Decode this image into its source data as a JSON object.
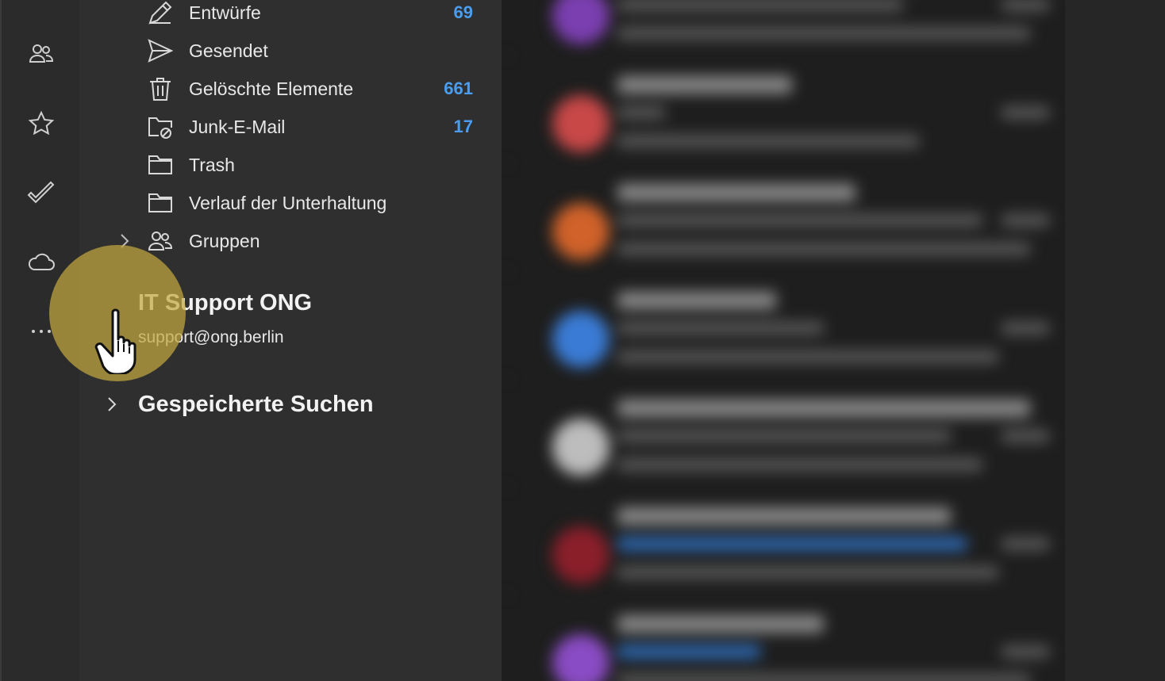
{
  "rail": {
    "icons": [
      "people-icon",
      "star-icon",
      "checkmark-icon",
      "cloud-icon",
      "more-icon"
    ]
  },
  "folders": [
    {
      "label": "Entwürfe",
      "count": "69",
      "icon": "draft-pencil-icon"
    },
    {
      "label": "Gesendet",
      "count": "",
      "icon": "send-icon"
    },
    {
      "label": "Gelöschte Elemente",
      "count": "661",
      "icon": "trash-icon"
    },
    {
      "label": "Junk-E-Mail",
      "count": "17",
      "icon": "junk-folder-icon"
    },
    {
      "label": "Trash",
      "count": "",
      "icon": "folder-icon"
    },
    {
      "label": "Verlauf der Unterhaltung",
      "count": "",
      "icon": "folder-icon"
    },
    {
      "label": "Gruppen",
      "count": "",
      "icon": "groups-icon"
    }
  ],
  "account": {
    "name": "IT Support ONG",
    "email": "support@ong.berlin"
  },
  "saved_searches": {
    "label": "Gespeicherte Suchen"
  },
  "colors": {
    "accent": "#4a9df0",
    "highlight": "#c4a83e",
    "avatars": [
      "#7b3fb0",
      "#c84848",
      "#d0622a",
      "#3a7bd5",
      "#bdbdbd",
      "#8a1f2a",
      "#8a4cc4"
    ]
  }
}
